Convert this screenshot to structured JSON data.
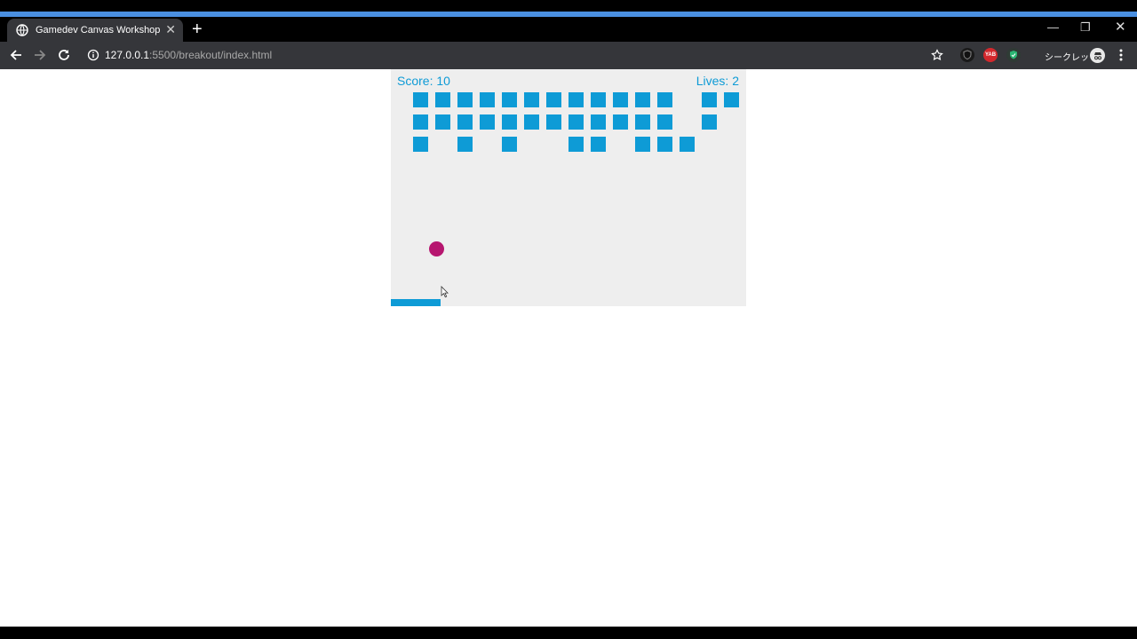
{
  "browser": {
    "tab_title": "Gamedev Canvas Workshop",
    "url_host": "127.0.0.1",
    "url_rest": ":5500/breakout/index.html",
    "incognito_label": "シークレット",
    "ext_badge": "YAB",
    "icons": [
      "globe-icon",
      "close-icon",
      "new-tab-icon",
      "minimize-icon",
      "restore-icon",
      "back-icon",
      "forward-icon",
      "reload-icon",
      "info-icon",
      "star-icon",
      "shield-icon",
      "menu-icon"
    ]
  },
  "game": {
    "score_label": "Score: 10",
    "lives_label": "Lives: 2",
    "score": 10,
    "lives": 2,
    "colors": {
      "brick": "#0e9bd6",
      "ball": "#b6166f",
      "paddle": "#0e9bd6",
      "background": "#eeeeee",
      "text": "#0e9bd6"
    },
    "brick_rows": [
      [
        1,
        1,
        1,
        1,
        1,
        1,
        1,
        1,
        1,
        1,
        1,
        1,
        0,
        1,
        1
      ],
      [
        1,
        1,
        1,
        1,
        1,
        1,
        1,
        1,
        1,
        1,
        1,
        1,
        0,
        1,
        0
      ],
      [
        1,
        0,
        1,
        0,
        1,
        0,
        0,
        1,
        1,
        0,
        1,
        1,
        1,
        0,
        0
      ]
    ]
  }
}
